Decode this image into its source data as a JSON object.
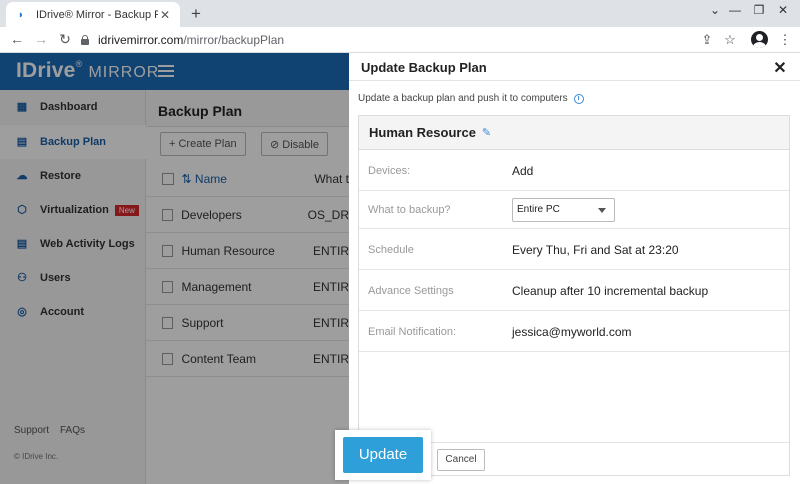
{
  "browser": {
    "tab_title": "IDrive® Mirror - Backup Plan",
    "tab_close": "✕",
    "new_tab": "+",
    "window_controls": [
      "⌄",
      "—",
      "❐",
      "✕"
    ],
    "url_host": "idrivemirror.com",
    "url_path": "/mirror/backupPlan",
    "nav": {
      "back": "←",
      "forward": "→",
      "reload": "↻"
    },
    "bar_icons": {
      "share": "⇪",
      "bookmark": "☆",
      "menu": "⋮"
    }
  },
  "app": {
    "logo_main": "IDrive",
    "logo_reg": "®",
    "logo_sub": "MIRROR",
    "sidebar": {
      "items": [
        {
          "label": "Dashboard",
          "icon": "▦"
        },
        {
          "label": "Backup Plan",
          "icon": "▤"
        },
        {
          "label": "Restore",
          "icon": "☁"
        },
        {
          "label": "Virtualization",
          "icon": "⬡",
          "badge": "New"
        },
        {
          "label": "Web Activity Logs",
          "icon": "▤"
        },
        {
          "label": "Users",
          "icon": "⚇"
        },
        {
          "label": "Account",
          "icon": "◎"
        }
      ],
      "footer_links": [
        "Support",
        "FAQs"
      ],
      "copyright": "© IDrive Inc."
    },
    "main": {
      "title": "Backup Plan",
      "create_label": "+ Create Plan",
      "disable_label": "⊘ Disable",
      "col_name": "⇅ Name",
      "col_what": "What t",
      "rows": [
        {
          "name": "Developers",
          "what": "OS_DR"
        },
        {
          "name": "Human Resource",
          "what": "ENTIR"
        },
        {
          "name": "Management",
          "what": "ENTIR"
        },
        {
          "name": "Support",
          "what": "ENTIR"
        },
        {
          "name": "Content Team",
          "what": "ENTIR"
        }
      ]
    }
  },
  "panel": {
    "title": "Update Backup Plan",
    "close": "✕",
    "subtitle": "Update a backup plan and push it to computers",
    "info": "i",
    "plan_name": "Human Resource",
    "edit_icon": "✎",
    "fields": [
      {
        "label": "Devices:",
        "value": "Add"
      },
      {
        "label": "What to backup?",
        "value": "Entire PC"
      },
      {
        "label": "Schedule",
        "value": "Every Thu, Fri and Sat at 23:20"
      },
      {
        "label": "Advance Settings",
        "value": "Cleanup after 10 incremental backup"
      },
      {
        "label": "Email Notification:",
        "value": "jessica@myworld.com"
      }
    ],
    "update_label": "Update",
    "cancel_label": "Cancel"
  }
}
